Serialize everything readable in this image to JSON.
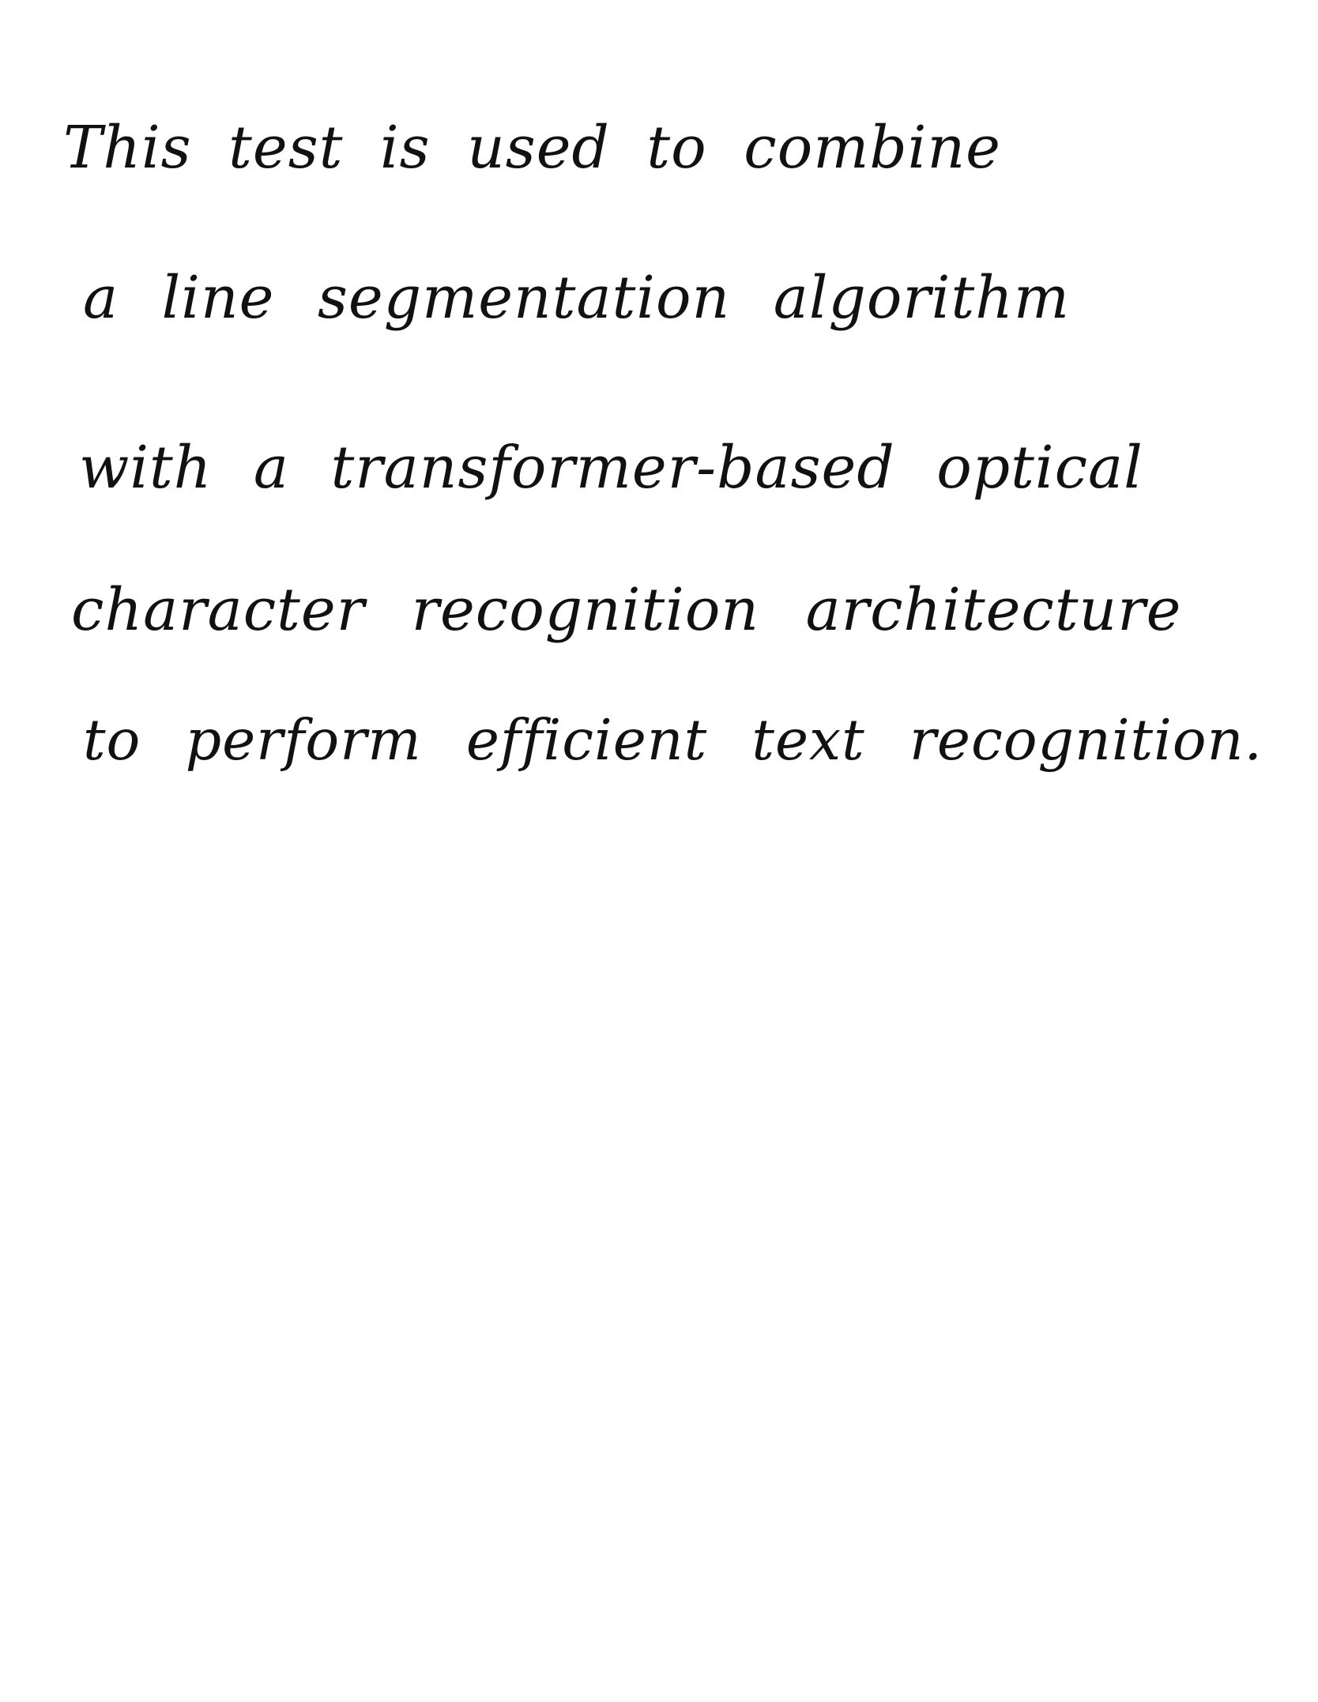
{
  "document": {
    "lines": [
      "This test is used to combine",
      "a line segmentation algorithm",
      "with a transformer-based optical",
      "character recognition architecture",
      "to perform efficient text recognition."
    ]
  },
  "colors": {
    "ink": "#111111",
    "paper": "#ffffff"
  }
}
